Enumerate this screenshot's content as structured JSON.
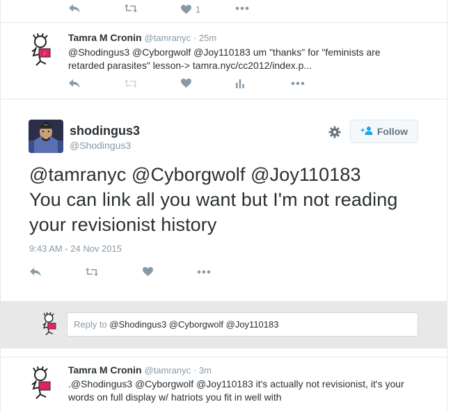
{
  "top_actions": {
    "like_count": "1"
  },
  "tweet1": {
    "name": "Tamra M Cronin",
    "handle": "@tamranyc",
    "time": "· 25m",
    "text_line1": "@Shodingus3 @Cyborgwolf @Joy110183 um \"thanks\" for \"feminists are",
    "text_line2": "retarded parasites\" lesson-> tamra.nyc/cc2012/index.p..."
  },
  "main_tweet": {
    "name": "shodingus3",
    "handle": "@Shodingus3",
    "follow_label": "Follow",
    "text_line1": "@tamranyc @Cyborgwolf @Joy110183",
    "text_line2": "You can link all you want but I'm not reading",
    "text_line3": "your revisionist history",
    "date": "9:43 AM - 24 Nov 2015"
  },
  "reply": {
    "prefix": "Reply to ",
    "mentions": "@Shodingus3 @Cyborgwolf @Joy110183"
  },
  "tweet2": {
    "name": "Tamra M Cronin",
    "handle": "@tamranyc",
    "time": "· 3m",
    "text_line1": ".@Shodingus3 @Cyborgwolf @Joy110183 it's actually not revisionist, it's your",
    "text_line2": "words on full display w/ hatriots you fit in well with"
  },
  "colors": {
    "accent": "#1da1f2",
    "muted": "#8899a6",
    "text": "#292f33",
    "border": "#e1e8ed"
  }
}
